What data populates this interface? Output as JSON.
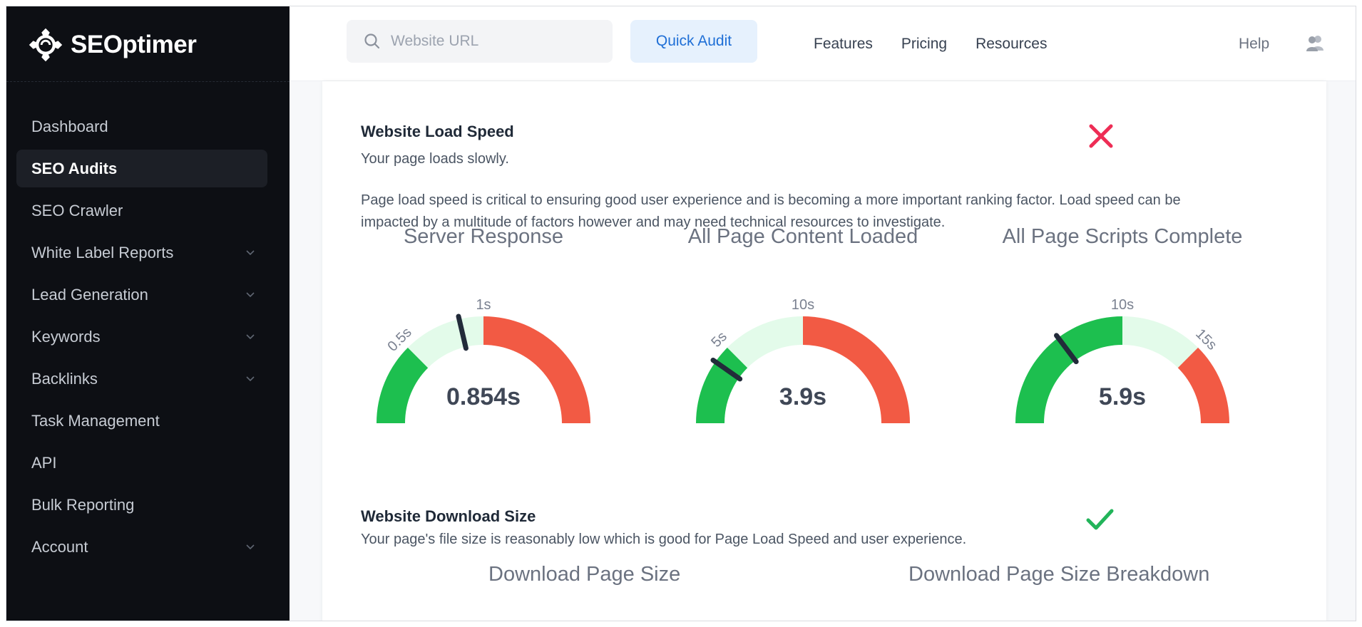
{
  "brand": {
    "name": "SEOptimer"
  },
  "sidebar": {
    "items": [
      {
        "label": "Dashboard",
        "active": false,
        "expandable": false
      },
      {
        "label": "SEO Audits",
        "active": true,
        "expandable": false
      },
      {
        "label": "SEO Crawler",
        "active": false,
        "expandable": false
      },
      {
        "label": "White Label Reports",
        "active": false,
        "expandable": true
      },
      {
        "label": "Lead Generation",
        "active": false,
        "expandable": true
      },
      {
        "label": "Keywords",
        "active": false,
        "expandable": true
      },
      {
        "label": "Backlinks",
        "active": false,
        "expandable": true
      },
      {
        "label": "Task Management",
        "active": false,
        "expandable": false
      },
      {
        "label": "API",
        "active": false,
        "expandable": false
      },
      {
        "label": "Bulk Reporting",
        "active": false,
        "expandable": false
      },
      {
        "label": "Account",
        "active": false,
        "expandable": true
      }
    ]
  },
  "header": {
    "search_placeholder": "Website URL",
    "quick_audit_label": "Quick Audit",
    "nav": [
      "Features",
      "Pricing",
      "Resources"
    ],
    "help_label": "Help"
  },
  "load_speed": {
    "title": "Website Load Speed",
    "subtitle": "Your page loads slowly.",
    "description": "Page load speed is critical to ensuring good user experience and is becoming a more important ranking factor. Load speed can be impacted by a multitude of factors however and may need technical resources to investigate.",
    "status": "fail",
    "gauges": [
      {
        "title": "Server Response",
        "value_label": "0.854s",
        "value": 0.854,
        "min": 0,
        "max": 2,
        "thresholds": [
          0.5,
          1
        ],
        "threshold_labels": [
          "0.5s",
          "1s"
        ],
        "bands": [
          "good",
          "ok",
          "bad"
        ]
      },
      {
        "title": "All Page Content Loaded",
        "value_label": "3.9s",
        "value": 3.9,
        "min": 0,
        "max": 20,
        "thresholds": [
          5,
          10
        ],
        "threshold_labels": [
          "5s",
          "10s"
        ],
        "bands": [
          "good",
          "ok",
          "bad"
        ]
      },
      {
        "title": "All Page Scripts Complete",
        "value_label": "5.9s",
        "value": 5.9,
        "min": 0,
        "max": 20,
        "thresholds": [
          10,
          15
        ],
        "threshold_labels": [
          "10s",
          "15s"
        ],
        "bands": [
          "good",
          "ok",
          "bad"
        ]
      }
    ]
  },
  "download_size": {
    "title": "Website Download Size",
    "subtitle": "Your page's file size is reasonably low which is good for Page Load Speed and user experience.",
    "status": "pass",
    "sub_titles": [
      "Download Page Size",
      "Download Page Size Breakdown"
    ]
  },
  "colors": {
    "good": "#1dbf4f",
    "ok": "#e3fbea",
    "bad": "#f25a44",
    "needle": "#222b3a",
    "fail": "#ee2d55",
    "pass": "#22b45a"
  },
  "icons": {
    "logo": "seoptimer-logo-icon",
    "search": "search-icon",
    "user": "users-icon",
    "chevron": "chevron-down-icon",
    "fail": "cross-icon",
    "pass": "check-icon",
    "chat": "chat-icon"
  }
}
